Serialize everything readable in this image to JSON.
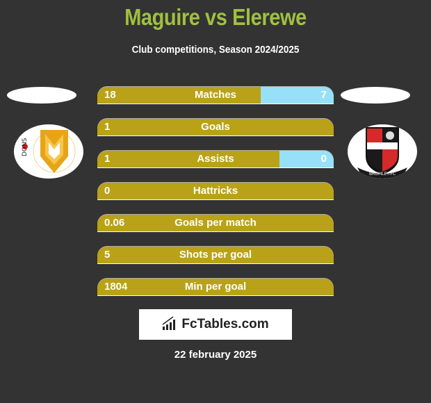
{
  "header": {
    "title": "Maguire vs Elerewe",
    "subtitle": "Club competitions, Season 2024/2025"
  },
  "teams": {
    "left": {
      "logo_icon": "mk-dons-crest-icon"
    },
    "right": {
      "logo_icon": "bromley-fc-crest-icon",
      "logo_text": "BROMLEY-FC"
    }
  },
  "colors": {
    "title": "#a0c040",
    "left_bar": "#b9a218",
    "right_bar": "#97e1f8",
    "background": "#333333"
  },
  "stats": [
    {
      "label": "Matches",
      "left": "18",
      "right": "7",
      "left_share": 0.69
    },
    {
      "label": "Goals",
      "left": "1",
      "right": "",
      "left_share": 1
    },
    {
      "label": "Assists",
      "left": "1",
      "right": "0",
      "left_share": 0.77
    },
    {
      "label": "Hattricks",
      "left": "0",
      "right": "",
      "left_share": 1
    },
    {
      "label": "Goals per match",
      "left": "0.06",
      "right": "",
      "left_share": 1
    },
    {
      "label": "Shots per goal",
      "left": "5",
      "right": "",
      "left_share": 1
    },
    {
      "label": "Min per goal",
      "left": "1804",
      "right": "",
      "left_share": 1
    }
  ],
  "footer": {
    "brand": "FcTables.com",
    "date": "22 february 2025"
  }
}
